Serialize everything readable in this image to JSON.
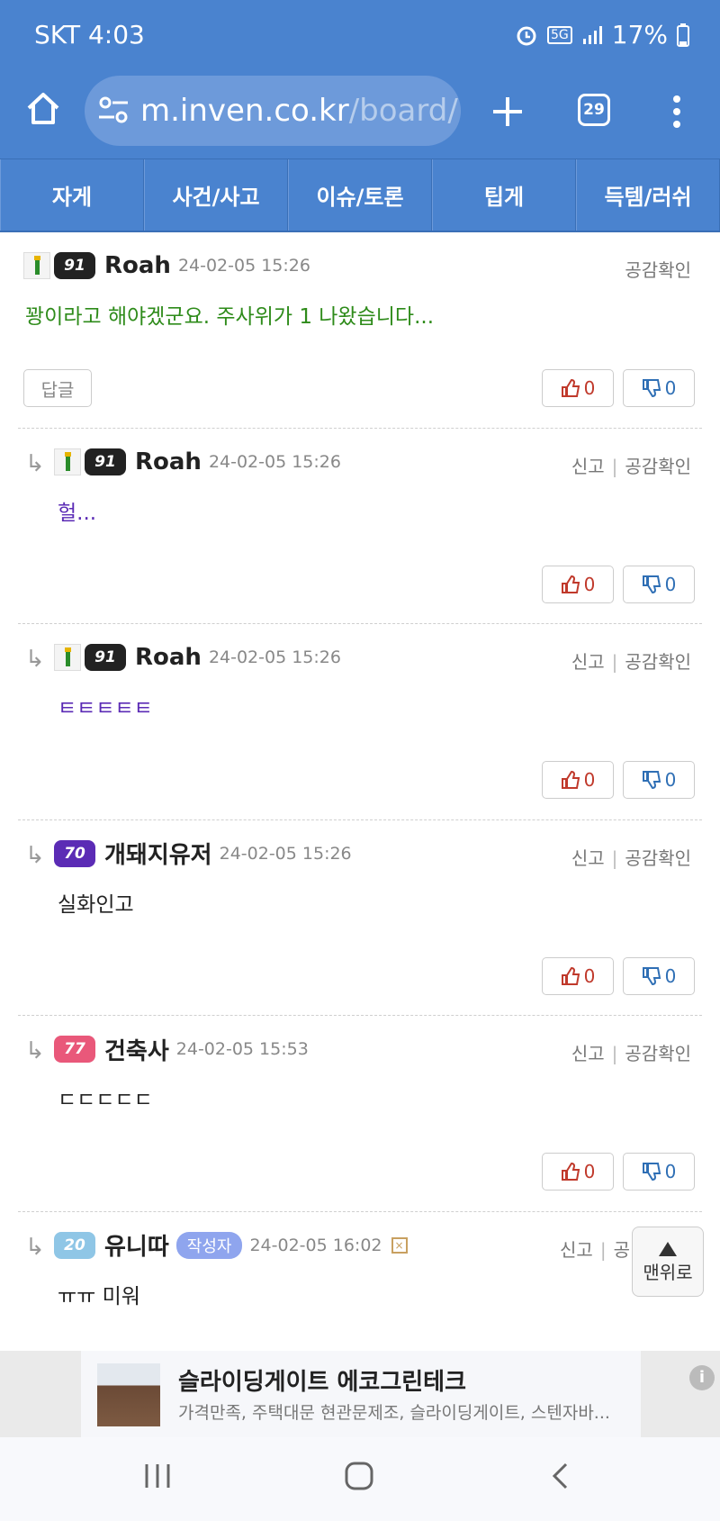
{
  "status": {
    "carrier": "SKT 4:03",
    "net": "5G",
    "battery": "17%"
  },
  "browser": {
    "url_host": "m.inven.co.kr",
    "url_path": "/board/lir",
    "tab_count": "29"
  },
  "categories": [
    "자게",
    "사건/사고",
    "이슈/토론",
    "팁게",
    "득템/러쉬"
  ],
  "comments": [
    {
      "nick": "Roah",
      "level": "91",
      "date": "24-02-05 15:26",
      "tools_a": "공감확인",
      "text": "꽝이라고 해야겠군요. 주사위가 1 나왔습니다...",
      "reply": "답글",
      "up": "0",
      "down": "0"
    },
    {
      "nick": "Roah",
      "level": "91",
      "date": "24-02-05 15:26",
      "tools_a": "신고",
      "tools_b": "공감확인",
      "text": "헐...",
      "up": "0",
      "down": "0"
    },
    {
      "nick": "Roah",
      "level": "91",
      "date": "24-02-05 15:26",
      "tools_a": "신고",
      "tools_b": "공감확인",
      "text": "ㅌㅌㅌㅌㅌ",
      "up": "0",
      "down": "0"
    },
    {
      "nick": "개돼지유저",
      "level": "70",
      "date": "24-02-05 15:26",
      "tools_a": "신고",
      "tools_b": "공감확인",
      "text": "실화인고",
      "up": "0",
      "down": "0"
    },
    {
      "nick": "건축사",
      "level": "77",
      "date": "24-02-05 15:53",
      "tools_a": "신고",
      "tools_b": "공감확인",
      "text": "ㄷㄷㄷㄷㄷ",
      "up": "0",
      "down": "0"
    },
    {
      "nick": "유니따",
      "level": "20",
      "badge": "작성자",
      "date": "24-02-05 16:02",
      "tools_a": "신고",
      "tools_b": "공",
      "text": "ㅠㅠ 미워"
    }
  ],
  "to_top": {
    "label": "맨위로"
  },
  "ad": {
    "title": "슬라이딩게이트 에코그린테크",
    "desc": "가격만족, 주택대문 현관문제조, 슬라이딩게이트, 스텐자바...",
    "info": "i"
  },
  "icons": [
    "home-icon",
    "tune-icon",
    "plus-icon",
    "more-icon",
    "thumb-up-icon",
    "thumb-down-icon",
    "reply-arrow-icon",
    "recents-icon",
    "home-nav-icon",
    "back-icon"
  ]
}
